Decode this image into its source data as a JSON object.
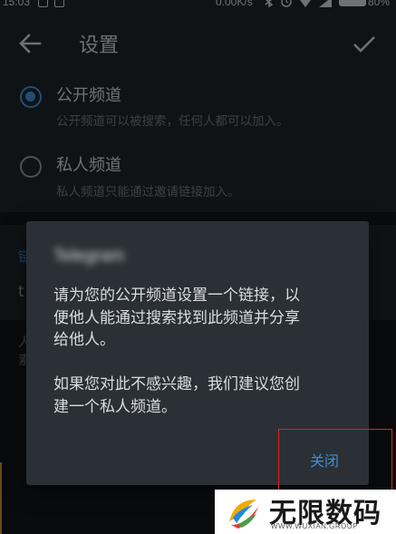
{
  "status_bar": {
    "time": "15:03",
    "network_speed": "0.00K/s",
    "battery_percent": "80%",
    "icons": [
      "photo-icon",
      "notification-icon",
      "bluetooth-icon",
      "alarm-icon",
      "wifi-icon",
      "signal-icon",
      "battery-icon"
    ]
  },
  "app_bar": {
    "title": "设置",
    "back_icon": "arrow-left-icon",
    "done_icon": "checkmark-icon"
  },
  "channel_type": {
    "options": [
      {
        "title": "公开频道",
        "description": "公开频道可以被搜索，任何人都可以加入。",
        "selected": true
      },
      {
        "title": "私人频道",
        "description": "私人频道只能通过邀请链接加入。",
        "selected": false
      }
    ]
  },
  "link_section": {
    "label_partial": "链",
    "prefix_partial": "t"
  },
  "bottom_section": {
    "line1_partial": "人",
    "line2_partial": "素"
  },
  "dialog": {
    "title": "Telegram",
    "message": "请为您的公开频道设置一个链接，以\n便他人能通过搜索找到此频道并分享\n给他人。\n\n如果您对此不感兴趣，我们建议您创\n建一个私人频道。",
    "close_label": "关闭"
  },
  "watermark": {
    "text": "无限数码",
    "url": "WWW.WUXIAN.GROUP"
  },
  "colors": {
    "accent": "#3e8fd6",
    "highlight": "#d8262b",
    "dialog_bg": "#2a3035"
  }
}
